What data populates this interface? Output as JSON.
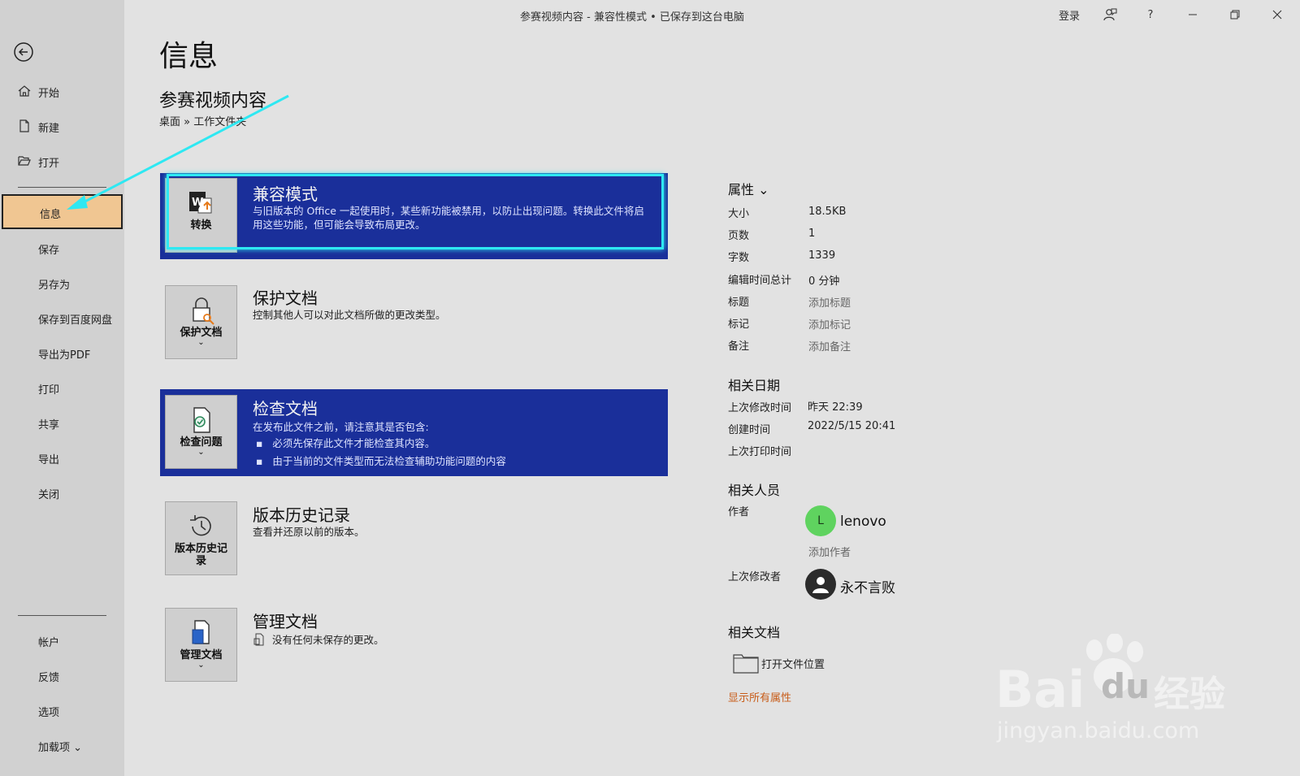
{
  "titlebar": {
    "text": "参赛视频内容  -  兼容性模式 • 已保存到这台电脑",
    "login": "登录",
    "help": "?"
  },
  "sidebar": {
    "items": [
      {
        "label": "开始",
        "icon": "home-icon"
      },
      {
        "label": "新建",
        "icon": "new-document-icon"
      },
      {
        "label": "打开",
        "icon": "folder-open-icon"
      },
      {
        "label": "信息"
      },
      {
        "label": "保存"
      },
      {
        "label": "另存为"
      },
      {
        "label": "保存到百度网盘"
      },
      {
        "label": "导出为PDF"
      },
      {
        "label": "打印"
      },
      {
        "label": "共享"
      },
      {
        "label": "导出"
      },
      {
        "label": "关闭"
      },
      {
        "label": "帐户"
      },
      {
        "label": "反馈"
      },
      {
        "label": "选项"
      },
      {
        "label": "加载项 ⌄"
      }
    ]
  },
  "main": {
    "page_title": "信息",
    "doc_title": "参赛视频内容",
    "breadcrumb": "桌面 » 工作文件夹",
    "cards": [
      {
        "tile_label": "转换",
        "title": "兼容模式",
        "desc": "与旧版本的 Office 一起使用时，某些新功能被禁用，以防止出现问题。转换此文件将启用这些功能，但可能会导致布局更改。"
      },
      {
        "tile_label": "保护文档",
        "tile_chevron": "⌄",
        "title": "保护文档",
        "desc": "控制其他人可以对此文档所做的更改类型。"
      },
      {
        "tile_label": "检查问题",
        "tile_chevron": "⌄",
        "title": "检查文档",
        "desc": "在发布此文件之前，请注意其是否包含:",
        "bullets": [
          "必须先保存此文件才能检查其内容。",
          "由于当前的文件类型而无法检查辅助功能问题的内容"
        ]
      },
      {
        "tile_label": "版本历史记录",
        "title": "版本历史记录",
        "desc": "查看并还原以前的版本。"
      },
      {
        "tile_label": "管理文档",
        "tile_chevron": "⌄",
        "title": "管理文档",
        "desc": "没有任何未保存的更改。"
      }
    ]
  },
  "properties": {
    "header": "属性 ⌄",
    "rows": [
      {
        "label": "大小",
        "value": "18.5KB"
      },
      {
        "label": "页数",
        "value": "1"
      },
      {
        "label": "字数",
        "value": "1339"
      },
      {
        "label": "编辑时间总计",
        "value": "0 分钟"
      },
      {
        "label": "标题",
        "value": "添加标题"
      },
      {
        "label": "标记",
        "value": "添加标记"
      },
      {
        "label": "备注",
        "value": "添加备注"
      }
    ]
  },
  "dates": {
    "header": "相关日期",
    "rows": [
      {
        "label": "上次修改时间",
        "value": "昨天 22:39"
      },
      {
        "label": "创建时间",
        "value": "2022/5/15 20:41"
      },
      {
        "label": "上次打印时间",
        "value": ""
      }
    ]
  },
  "people": {
    "header": "相关人员",
    "author_label": "作者",
    "author_initial": "L",
    "author_name": "lenovo",
    "add_author": "添加作者",
    "modifier_label": "上次修改者",
    "modifier_name": "永不言败"
  },
  "related_docs": {
    "header": "相关文档",
    "open_location": "打开文件位置",
    "show_all": "显示所有属性"
  },
  "watermark": {
    "brand": "Bai",
    "brand2": "du",
    "cn": "经验",
    "url": "jingyan.baidu.com"
  },
  "colors": {
    "accent_blue": "#1a2f9a",
    "highlight_cyan": "#2ee8f2",
    "active_nav": "#f0c692",
    "link_orange": "#c85d1a",
    "avatar_green": "#5fd35f"
  }
}
